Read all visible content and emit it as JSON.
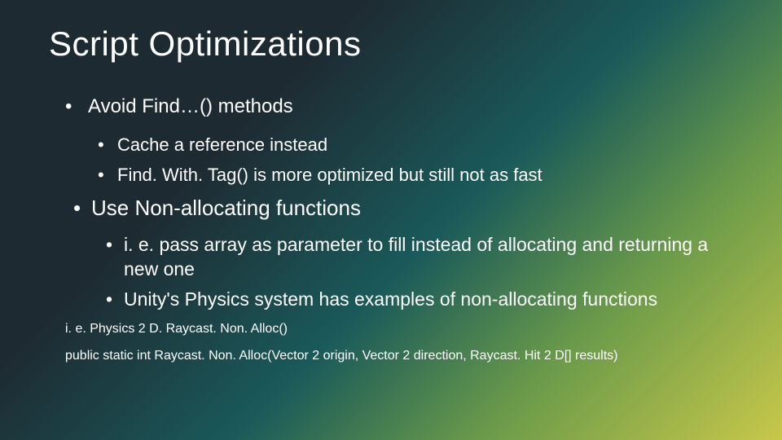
{
  "title": "Script Optimizations",
  "bullets": {
    "avoid_find": "Avoid Find…() methods",
    "cache_ref": "Cache a reference instead",
    "find_with_tag": "Find. With. Tag() is more optimized but still not as fast",
    "non_alloc": "Use Non-allocating functions",
    "pass_array": "i. e. pass array as parameter to fill instead of allocating and returning a new one",
    "unity_physics": "Unity's Physics system has examples of non-allocating functions"
  },
  "footnotes": {
    "example": "i. e. Physics 2 D. Raycast. Non. Alloc()",
    "signature": "public static int Raycast. Non. Alloc(Vector 2 origin, Vector 2 direction, Raycast. Hit 2 D[] results)"
  }
}
